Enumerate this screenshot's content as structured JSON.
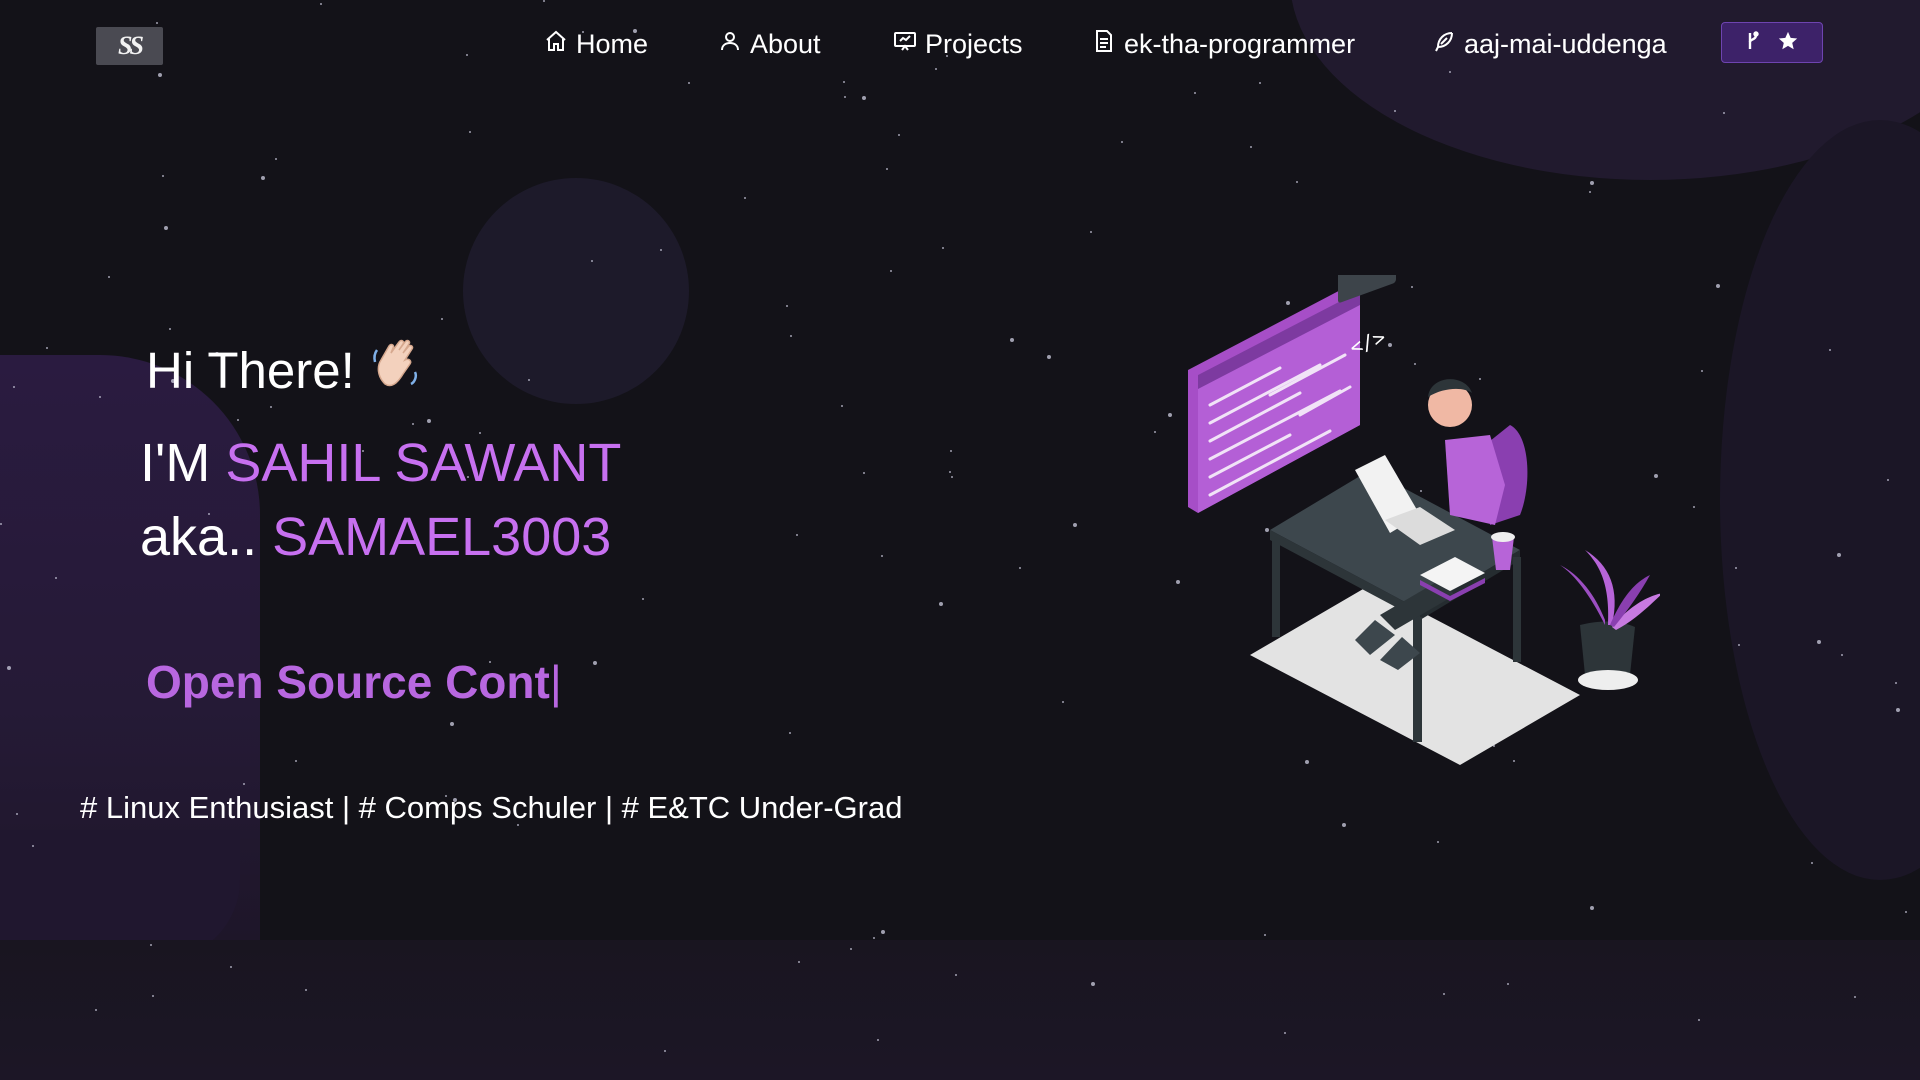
{
  "nav": {
    "logo_text": "SS",
    "items": [
      {
        "label": "Home",
        "icon": "home-icon"
      },
      {
        "label": "About",
        "icon": "user-icon"
      },
      {
        "label": "Projects",
        "icon": "projects-icon"
      },
      {
        "label": "ek-tha-programmer",
        "icon": "document-icon"
      },
      {
        "label": "aaj-mai-uddenga",
        "icon": "feather-icon"
      }
    ],
    "github_button": {
      "icons": [
        "git-fork-icon",
        "star-icon"
      ]
    }
  },
  "hero": {
    "greeting": "Hi There!",
    "greeting_emoji": "waving-hand",
    "im_prefix": "I'M",
    "name": "SAHIL SAWANT",
    "aka_prefix": "aka..",
    "alias": "SAMAEL3003",
    "typed_text": "Open Source Cont",
    "typed_cursor": "|",
    "tags": "# Linux Enthusiast | # Comps Schuler | # E&TC Under-Grad"
  },
  "colors": {
    "background": "#131218",
    "accent": "#c770f0",
    "button_bg": "#3d2269"
  }
}
